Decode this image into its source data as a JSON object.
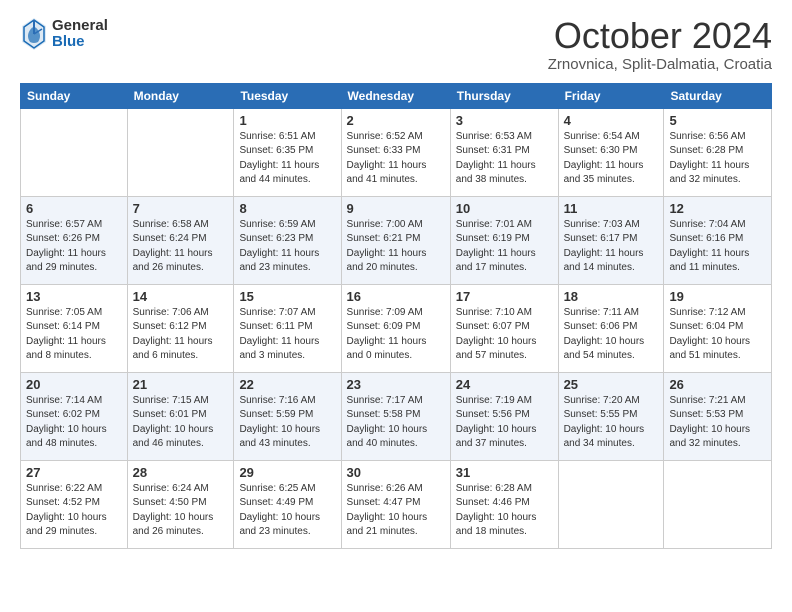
{
  "logo": {
    "general": "General",
    "blue": "Blue"
  },
  "title": "October 2024",
  "subtitle": "Zrnovnica, Split-Dalmatia, Croatia",
  "days_of_week": [
    "Sunday",
    "Monday",
    "Tuesday",
    "Wednesday",
    "Thursday",
    "Friday",
    "Saturday"
  ],
  "weeks": [
    [
      {
        "day": "",
        "info": ""
      },
      {
        "day": "",
        "info": ""
      },
      {
        "day": "1",
        "info": "Sunrise: 6:51 AM\nSunset: 6:35 PM\nDaylight: 11 hours and 44 minutes."
      },
      {
        "day": "2",
        "info": "Sunrise: 6:52 AM\nSunset: 6:33 PM\nDaylight: 11 hours and 41 minutes."
      },
      {
        "day": "3",
        "info": "Sunrise: 6:53 AM\nSunset: 6:31 PM\nDaylight: 11 hours and 38 minutes."
      },
      {
        "day": "4",
        "info": "Sunrise: 6:54 AM\nSunset: 6:30 PM\nDaylight: 11 hours and 35 minutes."
      },
      {
        "day": "5",
        "info": "Sunrise: 6:56 AM\nSunset: 6:28 PM\nDaylight: 11 hours and 32 minutes."
      }
    ],
    [
      {
        "day": "6",
        "info": "Sunrise: 6:57 AM\nSunset: 6:26 PM\nDaylight: 11 hours and 29 minutes."
      },
      {
        "day": "7",
        "info": "Sunrise: 6:58 AM\nSunset: 6:24 PM\nDaylight: 11 hours and 26 minutes."
      },
      {
        "day": "8",
        "info": "Sunrise: 6:59 AM\nSunset: 6:23 PM\nDaylight: 11 hours and 23 minutes."
      },
      {
        "day": "9",
        "info": "Sunrise: 7:00 AM\nSunset: 6:21 PM\nDaylight: 11 hours and 20 minutes."
      },
      {
        "day": "10",
        "info": "Sunrise: 7:01 AM\nSunset: 6:19 PM\nDaylight: 11 hours and 17 minutes."
      },
      {
        "day": "11",
        "info": "Sunrise: 7:03 AM\nSunset: 6:17 PM\nDaylight: 11 hours and 14 minutes."
      },
      {
        "day": "12",
        "info": "Sunrise: 7:04 AM\nSunset: 6:16 PM\nDaylight: 11 hours and 11 minutes."
      }
    ],
    [
      {
        "day": "13",
        "info": "Sunrise: 7:05 AM\nSunset: 6:14 PM\nDaylight: 11 hours and 8 minutes."
      },
      {
        "day": "14",
        "info": "Sunrise: 7:06 AM\nSunset: 6:12 PM\nDaylight: 11 hours and 6 minutes."
      },
      {
        "day": "15",
        "info": "Sunrise: 7:07 AM\nSunset: 6:11 PM\nDaylight: 11 hours and 3 minutes."
      },
      {
        "day": "16",
        "info": "Sunrise: 7:09 AM\nSunset: 6:09 PM\nDaylight: 11 hours and 0 minutes."
      },
      {
        "day": "17",
        "info": "Sunrise: 7:10 AM\nSunset: 6:07 PM\nDaylight: 10 hours and 57 minutes."
      },
      {
        "day": "18",
        "info": "Sunrise: 7:11 AM\nSunset: 6:06 PM\nDaylight: 10 hours and 54 minutes."
      },
      {
        "day": "19",
        "info": "Sunrise: 7:12 AM\nSunset: 6:04 PM\nDaylight: 10 hours and 51 minutes."
      }
    ],
    [
      {
        "day": "20",
        "info": "Sunrise: 7:14 AM\nSunset: 6:02 PM\nDaylight: 10 hours and 48 minutes."
      },
      {
        "day": "21",
        "info": "Sunrise: 7:15 AM\nSunset: 6:01 PM\nDaylight: 10 hours and 46 minutes."
      },
      {
        "day": "22",
        "info": "Sunrise: 7:16 AM\nSunset: 5:59 PM\nDaylight: 10 hours and 43 minutes."
      },
      {
        "day": "23",
        "info": "Sunrise: 7:17 AM\nSunset: 5:58 PM\nDaylight: 10 hours and 40 minutes."
      },
      {
        "day": "24",
        "info": "Sunrise: 7:19 AM\nSunset: 5:56 PM\nDaylight: 10 hours and 37 minutes."
      },
      {
        "day": "25",
        "info": "Sunrise: 7:20 AM\nSunset: 5:55 PM\nDaylight: 10 hours and 34 minutes."
      },
      {
        "day": "26",
        "info": "Sunrise: 7:21 AM\nSunset: 5:53 PM\nDaylight: 10 hours and 32 minutes."
      }
    ],
    [
      {
        "day": "27",
        "info": "Sunrise: 6:22 AM\nSunset: 4:52 PM\nDaylight: 10 hours and 29 minutes."
      },
      {
        "day": "28",
        "info": "Sunrise: 6:24 AM\nSunset: 4:50 PM\nDaylight: 10 hours and 26 minutes."
      },
      {
        "day": "29",
        "info": "Sunrise: 6:25 AM\nSunset: 4:49 PM\nDaylight: 10 hours and 23 minutes."
      },
      {
        "day": "30",
        "info": "Sunrise: 6:26 AM\nSunset: 4:47 PM\nDaylight: 10 hours and 21 minutes."
      },
      {
        "day": "31",
        "info": "Sunrise: 6:28 AM\nSunset: 4:46 PM\nDaylight: 10 hours and 18 minutes."
      },
      {
        "day": "",
        "info": ""
      },
      {
        "day": "",
        "info": ""
      }
    ]
  ]
}
